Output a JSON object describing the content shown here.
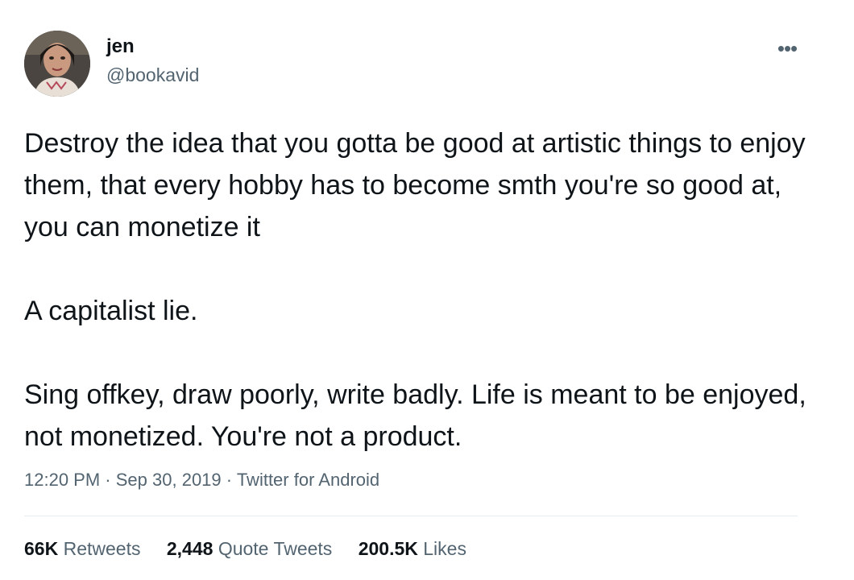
{
  "user": {
    "display_name": "jen",
    "handle": "@bookavid"
  },
  "more_icon": "more-horizontal-icon",
  "tweet": {
    "paragraphs": [
      "Destroy the idea that you gotta be good at artistic things to enjoy them, that every hobby has to become smth you're so good at, you can monetize it",
      "A capitalist lie.",
      "Sing offkey, draw poorly, write badly. Life is meant to be enjoyed, not monetized. You're not a product."
    ]
  },
  "meta": {
    "time": "12:20 PM",
    "sep1": "·",
    "date": "Sep 30, 2019",
    "sep2": "·",
    "source": "Twitter for Android"
  },
  "stats": {
    "retweets_count": "66K",
    "retweets_label": "Retweets",
    "quotes_count": "2,448",
    "quotes_label": "Quote Tweets",
    "likes_count": "200.5K",
    "likes_label": "Likes"
  },
  "colors": {
    "text_primary": "#0f1419",
    "text_secondary": "#536471",
    "divider": "#e6ecf0"
  }
}
